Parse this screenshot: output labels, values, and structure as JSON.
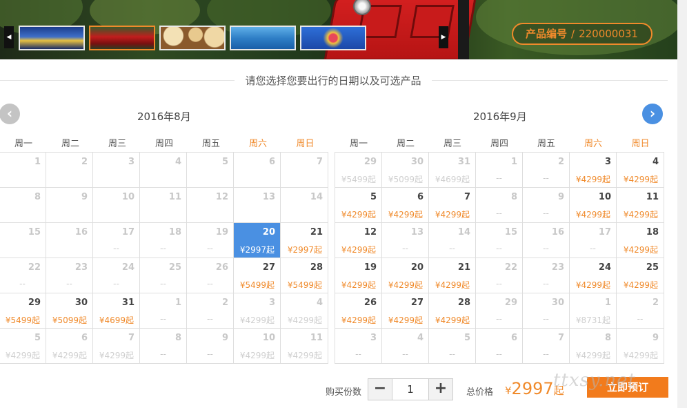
{
  "banner": {
    "thumbnails": [
      {
        "name": "city-skyline",
        "active": false
      },
      {
        "name": "peak-tram",
        "active": true
      },
      {
        "name": "dim-sum",
        "active": false
      },
      {
        "name": "dolphin",
        "active": false
      },
      {
        "name": "ferris-wheel",
        "active": false
      }
    ],
    "prev_icon": "◀",
    "next_icon": "▶",
    "product_label": "产品编号",
    "product_sep": "/",
    "product_code": "220000031"
  },
  "heading": "请您选择您要出行的日期以及可选产品",
  "nav": {
    "prev_icon": "‹",
    "next_icon": "›"
  },
  "weekdays": [
    "周一",
    "周二",
    "周三",
    "周四",
    "周五",
    "周六",
    "周日"
  ],
  "calendars": [
    {
      "title": "2016年8月",
      "weeks": [
        [
          {
            "d": "1",
            "p": ""
          },
          {
            "d": "2",
            "p": ""
          },
          {
            "d": "3",
            "p": ""
          },
          {
            "d": "4",
            "p": ""
          },
          {
            "d": "5",
            "p": ""
          },
          {
            "d": "6",
            "p": ""
          },
          {
            "d": "7",
            "p": ""
          }
        ],
        [
          {
            "d": "8",
            "p": ""
          },
          {
            "d": "9",
            "p": ""
          },
          {
            "d": "10",
            "p": ""
          },
          {
            "d": "11",
            "p": ""
          },
          {
            "d": "12",
            "p": ""
          },
          {
            "d": "13",
            "p": ""
          },
          {
            "d": "14",
            "p": ""
          }
        ],
        [
          {
            "d": "15",
            "p": ""
          },
          {
            "d": "16",
            "p": ""
          },
          {
            "d": "17",
            "p": "--"
          },
          {
            "d": "18",
            "p": "--"
          },
          {
            "d": "19",
            "p": "--"
          },
          {
            "d": "20",
            "p": "¥2997起",
            "s": "selected"
          },
          {
            "d": "21",
            "p": "¥2997起",
            "s": "avail"
          }
        ],
        [
          {
            "d": "22",
            "p": "--"
          },
          {
            "d": "23",
            "p": "--"
          },
          {
            "d": "24",
            "p": "--"
          },
          {
            "d": "25",
            "p": "--"
          },
          {
            "d": "26",
            "p": "--"
          },
          {
            "d": "27",
            "p": "¥5499起",
            "s": "avail"
          },
          {
            "d": "28",
            "p": "¥5499起",
            "s": "avail"
          }
        ],
        [
          {
            "d": "29",
            "p": "¥5499起",
            "s": "avail"
          },
          {
            "d": "30",
            "p": "¥5099起",
            "s": "avail"
          },
          {
            "d": "31",
            "p": "¥4699起",
            "s": "avail"
          },
          {
            "d": "1",
            "p": "--"
          },
          {
            "d": "2",
            "p": "--"
          },
          {
            "d": "3",
            "p": "¥4299起",
            "s": "past"
          },
          {
            "d": "4",
            "p": "¥4299起",
            "s": "past"
          }
        ],
        [
          {
            "d": "5",
            "p": "¥4299起",
            "s": "past"
          },
          {
            "d": "6",
            "p": "¥4299起",
            "s": "past"
          },
          {
            "d": "7",
            "p": "¥4299起",
            "s": "past"
          },
          {
            "d": "8",
            "p": "--"
          },
          {
            "d": "9",
            "p": "--"
          },
          {
            "d": "10",
            "p": "¥4299起",
            "s": "past"
          },
          {
            "d": "11",
            "p": "¥4299起",
            "s": "past"
          }
        ]
      ]
    },
    {
      "title": "2016年9月",
      "weeks": [
        [
          {
            "d": "29",
            "p": "¥5499起",
            "s": "past"
          },
          {
            "d": "30",
            "p": "¥5099起",
            "s": "past"
          },
          {
            "d": "31",
            "p": "¥4699起",
            "s": "past"
          },
          {
            "d": "1",
            "p": "--"
          },
          {
            "d": "2",
            "p": "--"
          },
          {
            "d": "3",
            "p": "¥4299起",
            "s": "avail"
          },
          {
            "d": "4",
            "p": "¥4299起",
            "s": "avail"
          }
        ],
        [
          {
            "d": "5",
            "p": "¥4299起",
            "s": "avail"
          },
          {
            "d": "6",
            "p": "¥4299起",
            "s": "avail"
          },
          {
            "d": "7",
            "p": "¥4299起",
            "s": "avail"
          },
          {
            "d": "8",
            "p": "--"
          },
          {
            "d": "9",
            "p": "--"
          },
          {
            "d": "10",
            "p": "¥4299起",
            "s": "avail"
          },
          {
            "d": "11",
            "p": "¥4299起",
            "s": "avail"
          }
        ],
        [
          {
            "d": "12",
            "p": "¥4299起",
            "s": "avail"
          },
          {
            "d": "13",
            "p": "--"
          },
          {
            "d": "14",
            "p": "--"
          },
          {
            "d": "15",
            "p": "--"
          },
          {
            "d": "16",
            "p": "--"
          },
          {
            "d": "17",
            "p": "--"
          },
          {
            "d": "18",
            "p": "¥4299起",
            "s": "avail"
          }
        ],
        [
          {
            "d": "19",
            "p": "¥4299起",
            "s": "avail"
          },
          {
            "d": "20",
            "p": "¥4299起",
            "s": "avail"
          },
          {
            "d": "21",
            "p": "¥4299起",
            "s": "avail"
          },
          {
            "d": "22",
            "p": "--"
          },
          {
            "d": "23",
            "p": "--"
          },
          {
            "d": "24",
            "p": "¥4299起",
            "s": "avail"
          },
          {
            "d": "25",
            "p": "¥4299起",
            "s": "avail"
          }
        ],
        [
          {
            "d": "26",
            "p": "¥4299起",
            "s": "avail"
          },
          {
            "d": "27",
            "p": "¥4299起",
            "s": "avail"
          },
          {
            "d": "28",
            "p": "¥4299起",
            "s": "avail"
          },
          {
            "d": "29",
            "p": "--"
          },
          {
            "d": "30",
            "p": "--"
          },
          {
            "d": "1",
            "p": "¥8731起",
            "s": "past"
          },
          {
            "d": "2",
            "p": "--"
          }
        ],
        [
          {
            "d": "3",
            "p": "--"
          },
          {
            "d": "4",
            "p": "--"
          },
          {
            "d": "5",
            "p": "--"
          },
          {
            "d": "6",
            "p": "--"
          },
          {
            "d": "7",
            "p": "--"
          },
          {
            "d": "8",
            "p": "¥4299起",
            "s": "past"
          },
          {
            "d": "9",
            "p": "¥4299起",
            "s": "past"
          }
        ]
      ]
    }
  ],
  "purchase": {
    "qty_label": "购买份数",
    "minus": "−",
    "plus": "+",
    "qty_value": "1",
    "total_label": "总价格",
    "currency": "¥",
    "total": "2997",
    "suffix": "起",
    "book_label": "立即预订",
    "watermark": "ttxsy.net"
  },
  "colors": {
    "accent": "#f08a2b",
    "selected": "#4a90e2",
    "button": "#f27b1c"
  }
}
